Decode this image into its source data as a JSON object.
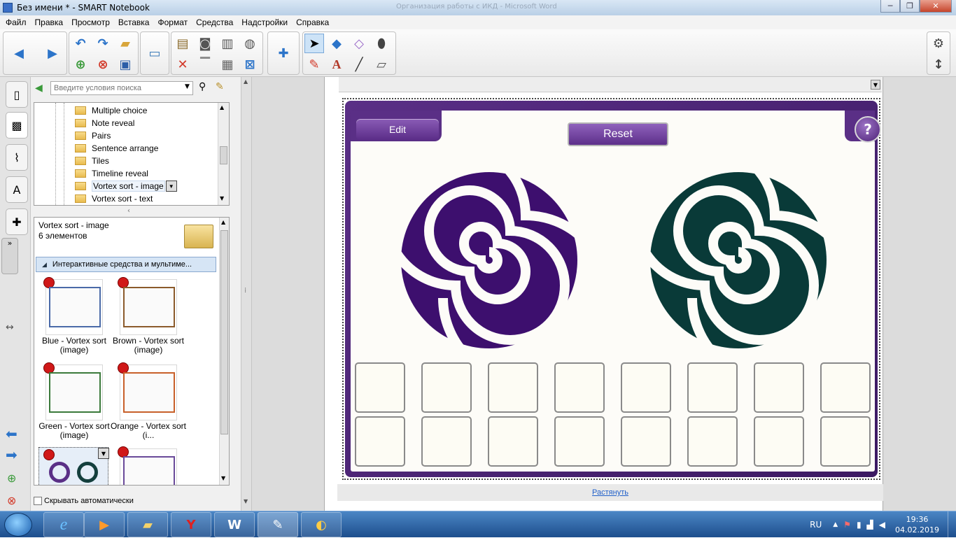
{
  "window": {
    "title": "Без имени * - SMART Notebook",
    "background_title": "Организация работы с ИКД - Microsoft Word"
  },
  "menu": [
    "Файл",
    "Правка",
    "Просмотр",
    "Вставка",
    "Формат",
    "Средства",
    "Надстройки",
    "Справка"
  ],
  "gallery": {
    "search_placeholder": "Введите условия поиска",
    "tree": [
      "Multiple choice",
      "Note reveal",
      "Pairs",
      "Sentence arrange",
      "Tiles",
      "Timeline reveal",
      "Vortex sort - image",
      "Vortex sort - text"
    ],
    "selected_title": "Vortex sort - image",
    "selected_count": "6 элементов",
    "category": "Интерактивные средства и мультиме...",
    "items": [
      {
        "label": "Blue - Vortex sort (image)",
        "color": "#4a6aa8"
      },
      {
        "label": "Brown - Vortex sort (image)",
        "color": "#8b5a2b"
      },
      {
        "label": "Green - Vortex sort (image)",
        "color": "#3b7a3b"
      },
      {
        "label": "Orange - Vortex sort (i...",
        "color": "#c8602a"
      },
      {
        "label": "",
        "color": "#5a2f86"
      },
      {
        "label": "",
        "color": "#6a4a9a"
      }
    ],
    "autohide": "Скрывать автоматически"
  },
  "widget": {
    "edit_label": "Edit",
    "reset_label": "Reset",
    "help_label": "?",
    "spiral_left_color": "#3d0f6e",
    "spiral_right_color": "#093a38",
    "drop_cells": 16
  },
  "stretch_link": "Растянуть",
  "tray": {
    "lang": "RU",
    "time": "19:36",
    "date": "04.02.2019"
  }
}
